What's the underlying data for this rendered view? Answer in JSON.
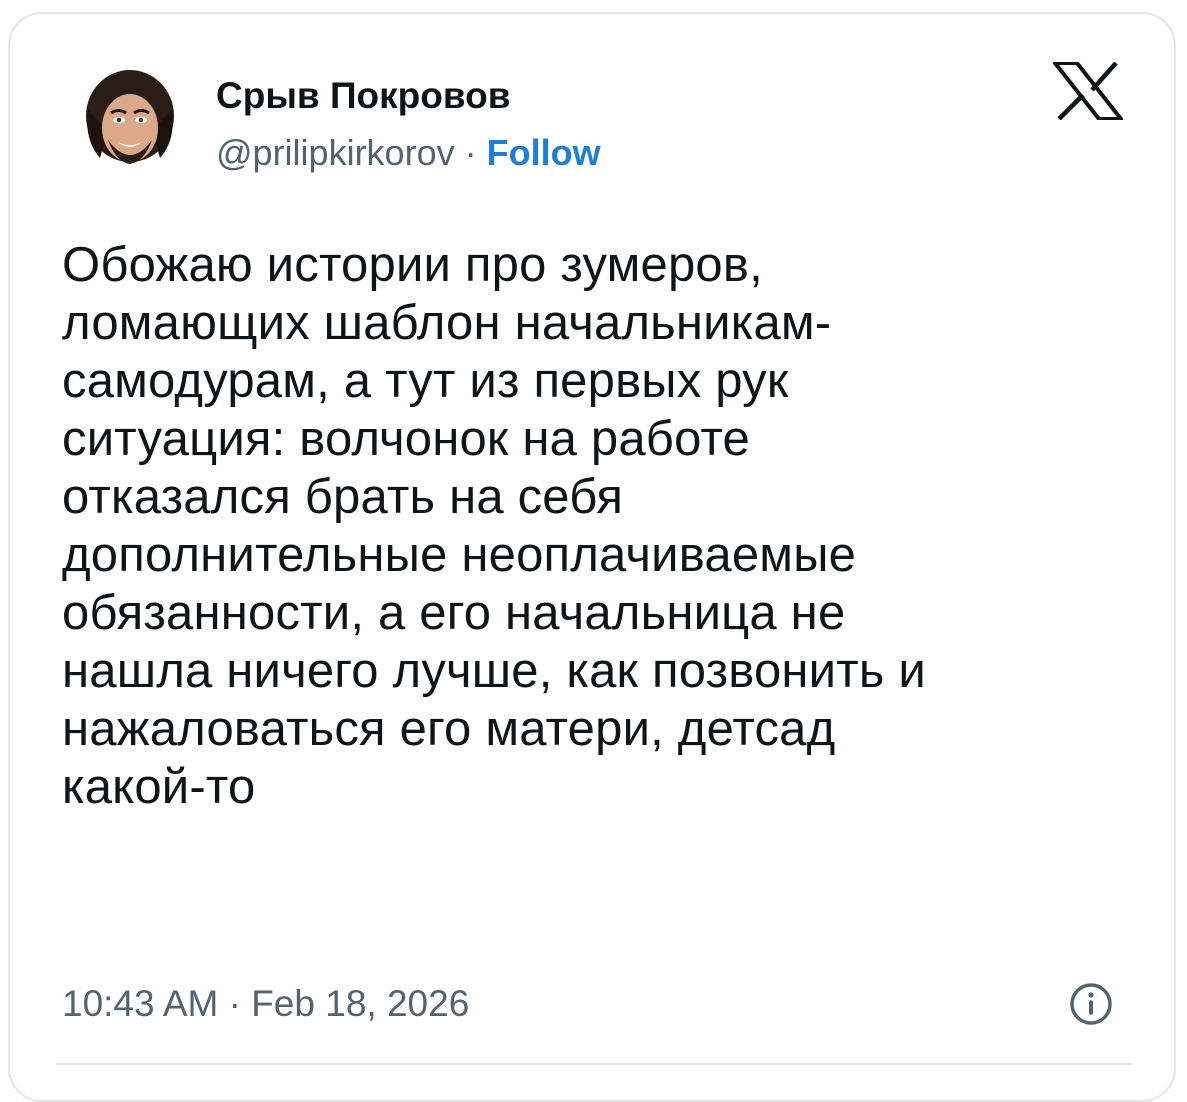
{
  "author": {
    "display_name": "Срыв Покровов",
    "handle": "@prilipkirkorov",
    "separator": "·",
    "follow_label": "Follow"
  },
  "tweet": {
    "text": "Обожаю истории про зумеров,\nломающих шаблон начальникам-\nсамодурам, а тут из первых рук\nситуация: волчонок на работе\nотказался брать на себя\nдополнительные неоплачиваемые\nобязанности, а его начальница не\nнашла ничего лучше, как позвонить и\nнажаловаться его матери, детсад\nкакой-то",
    "timestamp": "10:43 AM · Feb 18, 2026"
  },
  "icons": {
    "platform_logo": "x-logo-icon",
    "info": "info-icon"
  },
  "colors": {
    "follow": "#1d80d5",
    "secondary_text": "#536471",
    "primary_text": "#0f1419",
    "border": "#e1e6ea"
  }
}
